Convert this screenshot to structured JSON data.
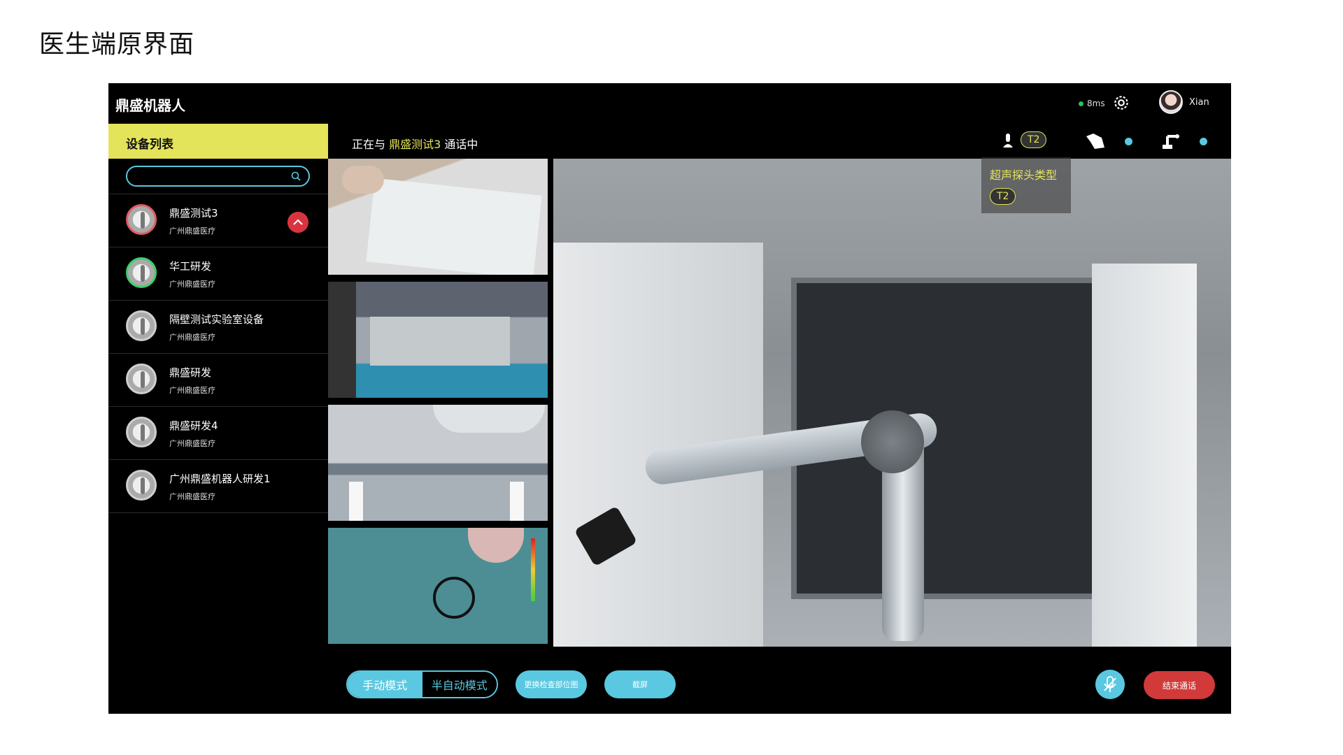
{
  "page": {
    "title": "医生端原界面"
  },
  "header": {
    "brand": "鼎盛机器人",
    "latency": "8ms",
    "username": "Xian"
  },
  "sidebar": {
    "title": "设备列表",
    "search": {
      "placeholder": ""
    },
    "devices": [
      {
        "name": "鼎盛测试3",
        "org": "广州鼎盛医疗",
        "status": "in-call"
      },
      {
        "name": "华工研发",
        "org": "广州鼎盛医疗",
        "status": "online"
      },
      {
        "name": "隔壁测试实验室设备",
        "org": "广州鼎盛医疗",
        "status": "offline"
      },
      {
        "name": "鼎盛研发",
        "org": "广州鼎盛医疗",
        "status": "offline"
      },
      {
        "name": "鼎盛研发4",
        "org": "广州鼎盛医疗",
        "status": "offline"
      },
      {
        "name": "广州鼎盛机器人研发1",
        "org": "广州鼎盛医疗",
        "status": "offline"
      }
    ]
  },
  "call": {
    "prefix": "正在与",
    "target": "鼎盛测试3",
    "suffix": "通话中",
    "probe_badge": "T2",
    "tooltip_title": "超声探头类型",
    "tooltip_badge": "T2"
  },
  "controls": {
    "mode_manual": "手动模式",
    "mode_semi": "半自动模式",
    "change_position": "更换检查部位图",
    "screenshot": "截屏",
    "end_call": "结束通话"
  },
  "colors": {
    "accent": "#5ac8e0",
    "highlight": "#e3e45a",
    "danger": "#d23a3a"
  }
}
